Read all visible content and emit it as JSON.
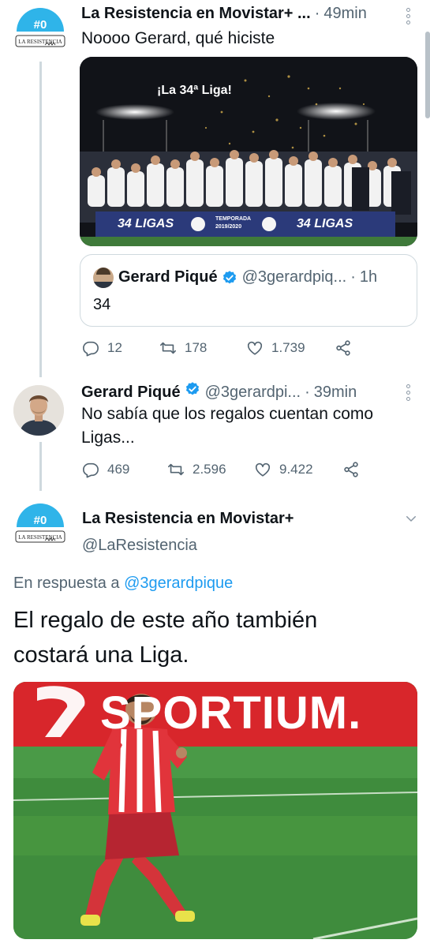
{
  "tweet1": {
    "name": "La Resistencia en Movistar+ ...",
    "time": "49min",
    "text": "Noooo Gerard, qué hiciste",
    "image": {
      "caption": "¡La 34ª Liga!",
      "banner_left": "34 LIGAS",
      "banner_center_top": "TEMPORADA",
      "banner_center_bottom": "2019/2020",
      "banner_right": "34 LIGAS"
    },
    "quote": {
      "name": "Gerard Piqué",
      "handle": "@3gerardpiq...",
      "time": "1h",
      "text": "34"
    },
    "actions": {
      "replies": "12",
      "retweets": "178",
      "likes": "1.739"
    }
  },
  "tweet2": {
    "name": "Gerard Piqué",
    "handle": "@3gerardpi...",
    "time": "39min",
    "text_line1": "No sabía que los regalos cuentan como",
    "text_line2": "Ligas...",
    "actions": {
      "replies": "469",
      "retweets": "2.596",
      "likes": "9.422"
    }
  },
  "tweet3": {
    "name": "La Resistencia en Movistar+",
    "handle": "@LaResistencia",
    "reply_prefix": "En respuesta a",
    "reply_to": "@3gerardpique",
    "text_line1": "El regalo de este año también",
    "text_line2": "costará una Liga.",
    "image": {
      "sign": "SPORTIUM."
    }
  },
  "logo": {
    "top": "#0",
    "bottom": "LA RESISTENCIA"
  },
  "colors": {
    "link": "#1d9bf0",
    "secondary": "#536471",
    "verified": "#1d9bf0",
    "thread": "#cfd9de"
  }
}
